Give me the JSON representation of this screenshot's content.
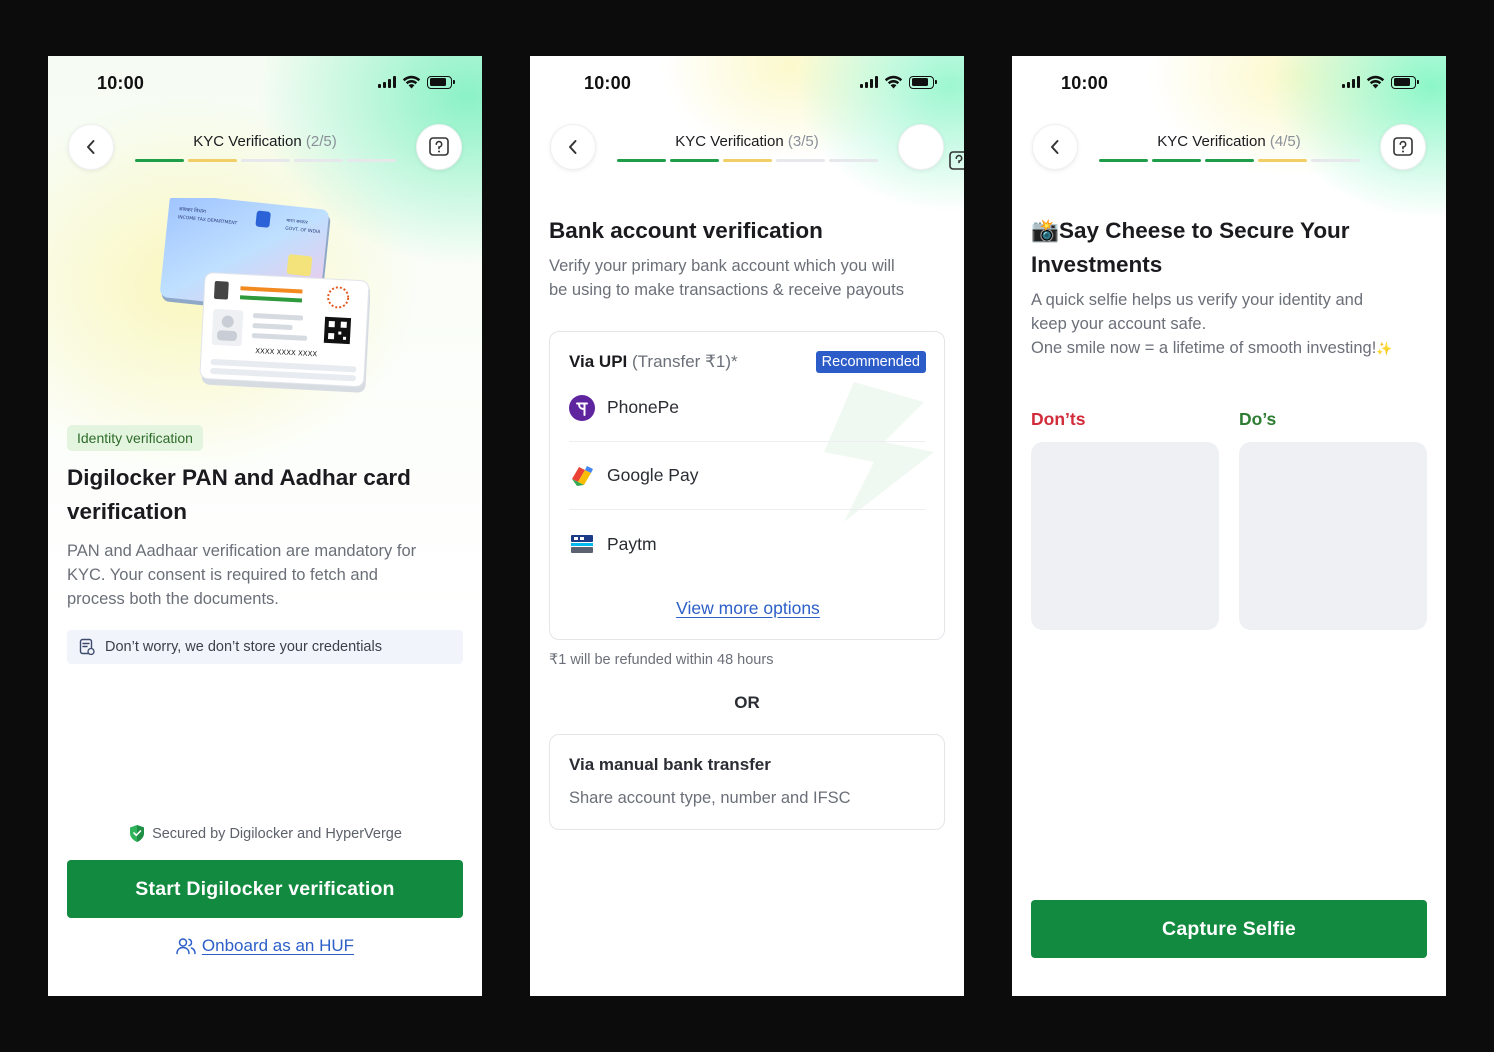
{
  "status_bar": {
    "time": "10:00"
  },
  "screen1": {
    "kyc_title": "KYC Verification",
    "kyc_step": "(2/5)",
    "tag": "Identity verification",
    "heading_line1": "Digilocker PAN and Aadhar card",
    "heading_line2": "verification",
    "body_line1": "PAN and Aadhaar verification are mandatory for",
    "body_line2": "KYC. Your consent is required to fetch and",
    "body_line3": "process both the documents.",
    "note": "Don’t worry, we don’t store your credentials",
    "secured": "Secured by Digilocker and HyperVerge",
    "cta": "Start Digilocker verification",
    "huf_link": "Onboard as an HUF",
    "card_texts": {
      "pan_hindi": "आयकर विभाग",
      "pan_dept": "INCOME TAX DEPARTMENT",
      "pan_govt_hindi": "भारत सरकार",
      "pan_govt": "GOVT. OF INDIA",
      "aadhaar_number": "XXXX XXXX XXXX"
    }
  },
  "screen2": {
    "kyc_title": "KYC Verification",
    "kyc_step": "(3/5)",
    "heading": "Bank account verification",
    "body_line1": "Verify your primary bank account which you will",
    "body_line2": "be using to make transactions & receive payouts",
    "upi_label": "Via UPI",
    "upi_sub": "(Transfer ₹1)*",
    "recommended": "Recommended",
    "options": [
      {
        "label": "PhonePe",
        "icon": "phonepe-icon",
        "color": "#5f259f"
      },
      {
        "label": "Google Pay",
        "icon": "google-pay-icon"
      },
      {
        "label": "Paytm",
        "icon": "paytm-icon"
      }
    ],
    "view_more": "View more options",
    "refund_note": "₹1 will be refunded within 48 hours",
    "or": "OR",
    "manual_title": "Via manual bank transfer",
    "manual_sub": "Share account type, number and IFSC"
  },
  "screen3": {
    "kyc_title": "KYC Verification",
    "kyc_step": "(4/5)",
    "heading_emoji": "📸",
    "heading_line1": "Say Cheese to Secure Your",
    "heading_line2": "Investments",
    "body_line1": "A quick selfie helps us verify your identity and",
    "body_line2": "keep your account safe.",
    "body_line3": "One smile now = a lifetime of smooth investing!",
    "sparkle": "✨",
    "donts": "Don’ts",
    "dos": "Do’s",
    "cta": "Capture Selfie"
  },
  "colors": {
    "primary_green": "#128a3f",
    "link_blue": "#2c5fc7",
    "donts_red": "#d22c3b",
    "dos_green": "#2e7d32",
    "progress_done": "#1f9e4a",
    "progress_current": "#f2cf66",
    "recommended_blue": "#2b5cc8"
  }
}
